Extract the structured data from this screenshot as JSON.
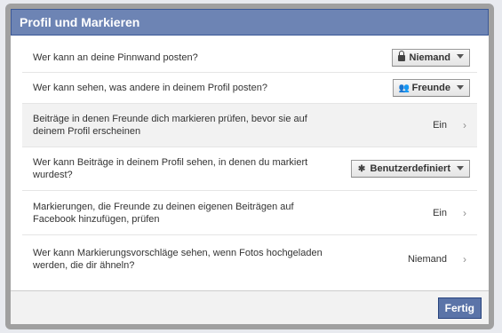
{
  "dialog": {
    "title": "Profil und Markieren",
    "done_label": "Fertig"
  },
  "rows": [
    {
      "label": "Wer kann an deine Pinnwand posten?",
      "control": "dropdown",
      "icon": "lock-icon",
      "value": "Niemand"
    },
    {
      "label": "Wer kann sehen, was andere in deinem Profil posten?",
      "control": "dropdown",
      "icon": "friends-icon",
      "value": "Freunde"
    },
    {
      "label": "Beiträge in denen Freunde dich markieren prüfen, bevor sie auf deinem Profil erscheinen",
      "control": "link",
      "value": "Ein"
    },
    {
      "label": "Wer kann Beiträge in deinem Profil sehen, in denen du markiert wurdest?",
      "control": "dropdown",
      "icon": "gear-icon",
      "value": "Benutzerdefiniert"
    },
    {
      "label": "Markierungen, die Freunde zu deinen eigenen Beiträgen auf Facebook hinzufügen, prüfen",
      "control": "link",
      "value": "Ein"
    },
    {
      "label": "Wer kann Markierungsvorschläge sehen, wenn Fotos hochgeladen werden, die dir ähneln?",
      "control": "link",
      "value": "Niemand"
    }
  ],
  "colors": {
    "title_bar": "#6d84b4",
    "title_border": "#3b5998",
    "button": "#5b74a8",
    "row_shade": "#f2f2f2"
  }
}
